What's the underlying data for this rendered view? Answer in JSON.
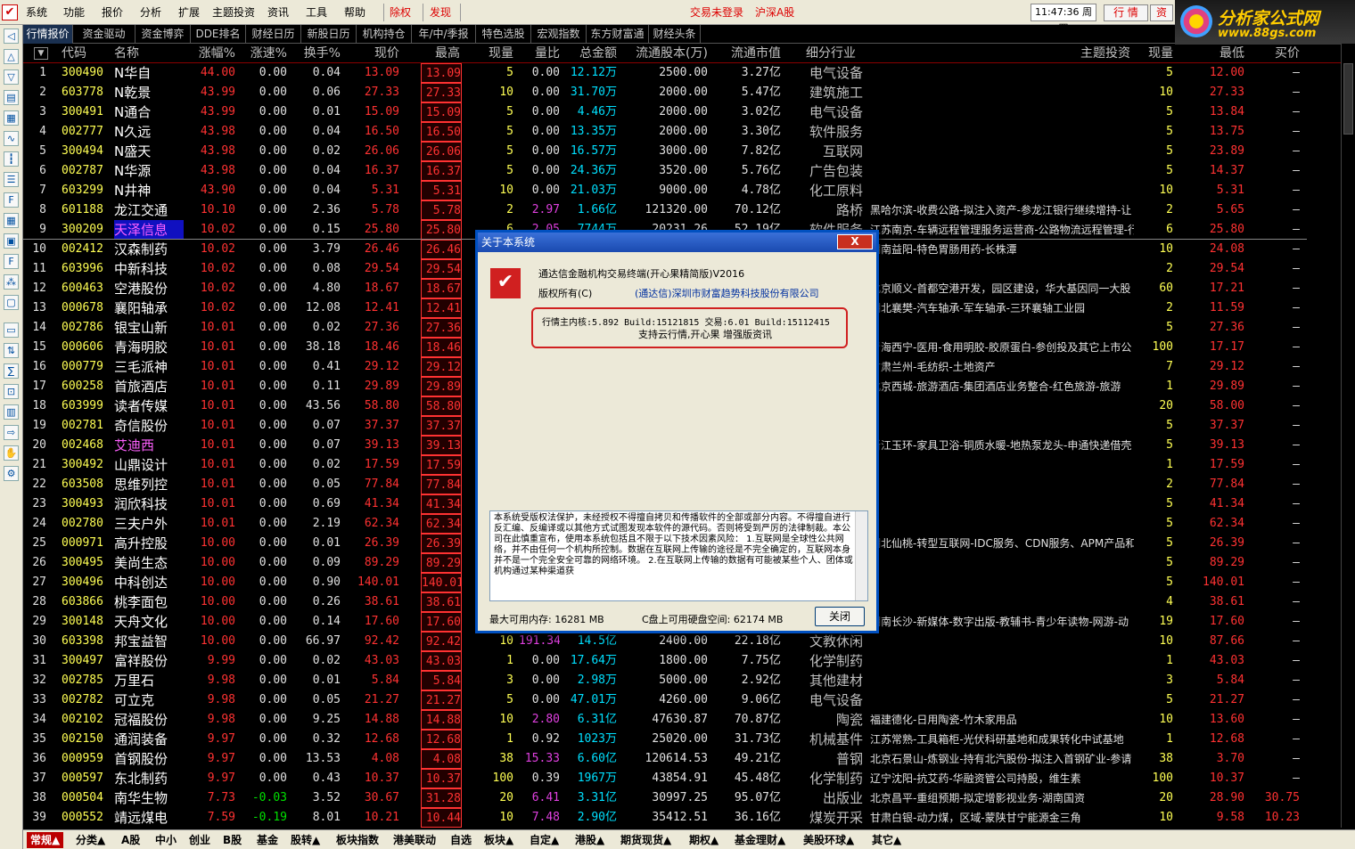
{
  "menubar": {
    "items": [
      "系统",
      "功能",
      "报价",
      "分析",
      "扩展",
      "主题投资",
      "资讯",
      "工具",
      "帮助"
    ],
    "red_items": [
      "除权",
      "发现"
    ],
    "status": "交易未登录",
    "market": "沪深A股",
    "clock": "11:47:36 周四",
    "trade_buttons": [
      "行 情",
      "资"
    ]
  },
  "brand": {
    "name": "分析家公式网",
    "url": "www.88gs.com"
  },
  "tabs": [
    "行情报价",
    "资金驱动",
    "资金博弈",
    "DDE排名",
    "财经日历",
    "新股日历",
    "机构持仓",
    "年/中/季报",
    "特色选股",
    "宏观指数",
    "东方财富通",
    "财经头条"
  ],
  "headers": [
    "代码",
    "名称",
    "涨幅%",
    "涨速%",
    "换手%",
    "现价",
    "最高",
    "现量",
    "量比",
    "总金额",
    "流通股本(万)",
    "流通市值",
    "细分行业",
    "主题投资",
    "现量",
    "最低",
    "买价"
  ],
  "rows": [
    [
      "1",
      "300490",
      "N华自",
      "44.00",
      "0.00",
      "0.04",
      "13.09",
      "13.09",
      "5",
      "0.00",
      "12.12万",
      "2500.00",
      "3.27亿",
      "电气设备",
      "",
      "5",
      "12.00",
      "—"
    ],
    [
      "2",
      "603778",
      "N乾景",
      "43.99",
      "0.00",
      "0.06",
      "27.33",
      "27.33",
      "10",
      "0.00",
      "31.70万",
      "2000.00",
      "5.47亿",
      "建筑施工",
      "",
      "10",
      "27.33",
      "—"
    ],
    [
      "3",
      "300491",
      "N通合",
      "43.99",
      "0.00",
      "0.01",
      "15.09",
      "15.09",
      "5",
      "0.00",
      "4.46万",
      "2000.00",
      "3.02亿",
      "电气设备",
      "",
      "5",
      "13.84",
      "—"
    ],
    [
      "4",
      "002777",
      "N久远",
      "43.98",
      "0.00",
      "0.04",
      "16.50",
      "16.50",
      "5",
      "0.00",
      "13.35万",
      "2000.00",
      "3.30亿",
      "软件服务",
      "",
      "5",
      "13.75",
      "—"
    ],
    [
      "5",
      "300494",
      "N盛天",
      "43.98",
      "0.00",
      "0.02",
      "26.06",
      "26.06",
      "5",
      "0.00",
      "16.57万",
      "3000.00",
      "7.82亿",
      "互联网",
      "",
      "5",
      "23.89",
      "—"
    ],
    [
      "6",
      "002787",
      "N华源",
      "43.98",
      "0.00",
      "0.04",
      "16.37",
      "16.37",
      "5",
      "0.00",
      "24.36万",
      "3520.00",
      "5.76亿",
      "广告包装",
      "",
      "5",
      "14.37",
      "—"
    ],
    [
      "7",
      "603299",
      "N井神",
      "43.90",
      "0.00",
      "0.04",
      "5.31",
      "5.31",
      "10",
      "0.00",
      "21.03万",
      "9000.00",
      "4.78亿",
      "化工原料",
      "",
      "10",
      "5.31",
      "—"
    ],
    [
      "8",
      "601188",
      "龙江交通",
      "10.10",
      "0.00",
      "2.36",
      "5.78",
      "5.78",
      "2",
      "2.97",
      "1.66亿",
      "121320.00",
      "70.12亿",
      "路桥",
      "黑哈尔滨-收费公路-拟注入资产-参龙江银行继续增持-让",
      "2",
      "5.65",
      "—"
    ],
    [
      "9",
      "300209",
      "天泽信息",
      "10.02",
      "0.00",
      "0.15",
      "25.80",
      "25.80",
      "6",
      "2.05",
      "7744万",
      "20231.26",
      "52.19亿",
      "软件服务",
      "江苏南京-车辆远程管理服务运营商-公路物流远程管理-行",
      "6",
      "25.80",
      "—"
    ],
    [
      "10",
      "002412",
      "汉森制药",
      "10.02",
      "0.00",
      "3.79",
      "26.46",
      "26.46",
      "",
      "",
      "",
      "",
      "",
      "",
      "湖南益阳-特色胃肠用药-长株潭",
      "10",
      "24.08",
      "—"
    ],
    [
      "11",
      "603996",
      "中新科技",
      "10.02",
      "0.00",
      "0.08",
      "29.54",
      "29.54",
      "",
      "",
      "",
      "",
      "",
      "",
      "",
      "2",
      "29.54",
      "—"
    ],
    [
      "12",
      "600463",
      "空港股份",
      "10.02",
      "0.00",
      "4.80",
      "18.67",
      "18.67",
      "",
      "",
      "",
      "",
      "",
      "",
      "北京顺义-首都空港开发，园区建设，华大基因同一大股",
      "60",
      "17.21",
      "—"
    ],
    [
      "13",
      "000678",
      "襄阳轴承",
      "10.02",
      "0.00",
      "12.08",
      "12.41",
      "12.41",
      "",
      "",
      "",
      "",
      "",
      "",
      "湖北襄樊-汽车轴承-军车轴承-三环襄轴工业园",
      "2",
      "11.59",
      "—"
    ],
    [
      "14",
      "002786",
      "银宝山新",
      "10.01",
      "0.00",
      "0.02",
      "27.36",
      "27.36",
      "",
      "",
      "",
      "",
      "",
      "",
      "",
      "5",
      "27.36",
      "—"
    ],
    [
      "15",
      "000606",
      "青海明胶",
      "10.01",
      "0.00",
      "38.18",
      "18.46",
      "18.46",
      "",
      "",
      "",
      "",
      "",
      "",
      "青海西宁-医用-食用明胶-胶原蛋白-参创投及其它上市公",
      "100",
      "17.17",
      "—"
    ],
    [
      "16",
      "000779",
      "三毛派神",
      "10.01",
      "0.00",
      "0.41",
      "29.12",
      "29.12",
      "",
      "",
      "",
      "",
      "",
      "",
      "甘肃兰州-毛纺织-土地资产",
      "7",
      "29.12",
      "—"
    ],
    [
      "17",
      "600258",
      "首旅酒店",
      "10.01",
      "0.00",
      "0.11",
      "29.89",
      "29.89",
      "",
      "",
      "",
      "",
      "",
      "",
      "北京西城-旅游酒店-集团酒店业务整合-红色旅游-旅游",
      "1",
      "29.89",
      "—"
    ],
    [
      "18",
      "603999",
      "读者传媒",
      "10.01",
      "0.00",
      "43.56",
      "58.80",
      "58.80",
      "",
      "",
      "",
      "",
      "",
      "",
      "",
      "20",
      "58.00",
      "—"
    ],
    [
      "19",
      "002781",
      "奇信股份",
      "10.01",
      "0.00",
      "0.07",
      "37.37",
      "37.37",
      "",
      "",
      "",
      "",
      "",
      "",
      "",
      "5",
      "37.37",
      "—"
    ],
    [
      "20",
      "002468",
      "艾迪西",
      "10.01",
      "0.00",
      "0.07",
      "39.13",
      "39.13",
      "",
      "",
      "",
      "",
      "",
      "",
      "浙江玉环-家具卫浴-铜质水暖-地热泵龙头-申通快递借壳",
      "5",
      "39.13",
      "—"
    ],
    [
      "21",
      "300492",
      "山鼎设计",
      "10.01",
      "0.00",
      "0.02",
      "17.59",
      "17.59",
      "",
      "",
      "",
      "",
      "",
      "",
      "",
      "1",
      "17.59",
      "—"
    ],
    [
      "22",
      "603508",
      "思维列控",
      "10.01",
      "0.00",
      "0.05",
      "77.84",
      "77.84",
      "",
      "",
      "",
      "",
      "",
      "",
      "",
      "2",
      "77.84",
      "—"
    ],
    [
      "23",
      "300493",
      "润欣科技",
      "10.01",
      "0.00",
      "0.69",
      "41.34",
      "41.34",
      "",
      "",
      "",
      "",
      "",
      "",
      "",
      "5",
      "41.34",
      "—"
    ],
    [
      "24",
      "002780",
      "三夫户外",
      "10.01",
      "0.00",
      "2.19",
      "62.34",
      "62.34",
      "",
      "",
      "",
      "",
      "",
      "",
      "",
      "5",
      "62.34",
      "—"
    ],
    [
      "25",
      "000971",
      "高升控股",
      "10.00",
      "0.00",
      "0.01",
      "26.39",
      "26.39",
      "",
      "",
      "",
      "",
      "",
      "",
      "湖北仙桃-转型互联网-IDC服务、CDN服务、APM产品和其",
      "5",
      "26.39",
      "—"
    ],
    [
      "26",
      "300495",
      "美尚生态",
      "10.00",
      "0.00",
      "0.09",
      "89.29",
      "89.29",
      "",
      "",
      "",
      "",
      "",
      "",
      "",
      "5",
      "89.29",
      "—"
    ],
    [
      "27",
      "300496",
      "中科创达",
      "10.00",
      "0.00",
      "0.90",
      "140.01",
      "140.01",
      "",
      "",
      "",
      "",
      "",
      "",
      "",
      "5",
      "140.01",
      "—"
    ],
    [
      "28",
      "603866",
      "桃李面包",
      "10.00",
      "0.00",
      "0.26",
      "38.61",
      "38.61",
      "",
      "",
      "",
      "",
      "",
      "",
      "",
      "4",
      "38.61",
      "—"
    ],
    [
      "29",
      "300148",
      "天舟文化",
      "10.00",
      "0.00",
      "0.14",
      "17.60",
      "17.60",
      "",
      "",
      "",
      "",
      "",
      "",
      "湖南长沙-新媒体-数字出版-教辅书-青少年读物-网游-动",
      "19",
      "17.60",
      "—"
    ],
    [
      "30",
      "603398",
      "邦宝益智",
      "10.00",
      "0.00",
      "66.97",
      "92.42",
      "92.42",
      "10",
      "191.34",
      "14.5亿",
      "2400.00",
      "22.18亿",
      "文教休闲",
      "",
      "10",
      "87.66",
      "—"
    ],
    [
      "31",
      "300497",
      "富祥股份",
      "9.99",
      "0.00",
      "0.02",
      "43.03",
      "43.03",
      "1",
      "0.00",
      "17.64万",
      "1800.00",
      "7.75亿",
      "化学制药",
      "",
      "1",
      "43.03",
      "—"
    ],
    [
      "32",
      "002785",
      "万里石",
      "9.98",
      "0.00",
      "0.01",
      "5.84",
      "5.84",
      "3",
      "0.00",
      "2.98万",
      "5000.00",
      "2.92亿",
      "其他建材",
      "",
      "3",
      "5.84",
      "—"
    ],
    [
      "33",
      "002782",
      "可立克",
      "9.98",
      "0.00",
      "0.05",
      "21.27",
      "21.27",
      "5",
      "0.00",
      "47.01万",
      "4260.00",
      "9.06亿",
      "电气设备",
      "",
      "5",
      "21.27",
      "—"
    ],
    [
      "34",
      "002102",
      "冠福股份",
      "9.98",
      "0.00",
      "9.25",
      "14.88",
      "14.88",
      "10",
      "2.80",
      "6.31亿",
      "47630.87",
      "70.87亿",
      "陶瓷",
      "福建德化-日用陶瓷-竹木家用品",
      "10",
      "13.60",
      "—"
    ],
    [
      "35",
      "002150",
      "通润装备",
      "9.97",
      "0.00",
      "0.32",
      "12.68",
      "12.68",
      "1",
      "0.92",
      "1023万",
      "25020.00",
      "31.73亿",
      "机械基件",
      "江苏常熟-工具箱柜-光伏科研基地和成果转化中试基地",
      "1",
      "12.68",
      "—"
    ],
    [
      "36",
      "000959",
      "首钢股份",
      "9.97",
      "0.00",
      "13.53",
      "4.08",
      "4.08",
      "38",
      "15.33",
      "6.60亿",
      "120614.53",
      "49.21亿",
      "普钢",
      "北京石景山-炼钢业-持有北汽股份-拟注入首钢矿业-参请",
      "38",
      "3.70",
      "—"
    ],
    [
      "37",
      "000597",
      "东北制药",
      "9.97",
      "0.00",
      "0.43",
      "10.37",
      "10.37",
      "100",
      "0.39",
      "1967万",
      "43854.91",
      "45.48亿",
      "化学制药",
      "辽宁沈阳-抗艾药-华融资管公司持股，维生素",
      "100",
      "10.37",
      "—"
    ],
    [
      "38",
      "000504",
      "南华生物",
      "7.73",
      "-0.03",
      "3.52",
      "30.67",
      "31.28",
      "20",
      "6.41",
      "3.31亿",
      "30997.25",
      "95.07亿",
      "出版业",
      "北京昌平-重组预期-拟定增影视业务-湖南国资",
      "20",
      "28.90",
      "30.75"
    ],
    [
      "39",
      "000552",
      "靖远煤电",
      "7.59",
      "-0.19",
      "8.01",
      "10.21",
      "10.44",
      "10",
      "7.48",
      "2.90亿",
      "35412.51",
      "36.16亿",
      "煤炭开采",
      "甘肃白银-动力煤，区域-蒙陕甘宁能源金三角",
      "10",
      "9.58",
      "10.23"
    ]
  ],
  "bottom_tabs": [
    "常规▲",
    "分类▲",
    "A股",
    "中小",
    "创业",
    "B股",
    "基金",
    "股转▲",
    "板块指数",
    "港美联动",
    "自选",
    "板块▲",
    "自定▲",
    "港股▲",
    "期货现货▲",
    "期权▲",
    "基金理财▲",
    "美股环球▲",
    "其它▲"
  ],
  "dialog": {
    "title": "关于本系统",
    "close": "X",
    "product": "通达信金融机构交易终端(开心果精简版)V2016",
    "copyright_label": "版权所有(C)",
    "company": "(通达信)深圳市财富趋势科技股份有限公司",
    "version_line": "行情主内核:5.892 Build:15121815 交易:6.01 Build:15112415",
    "support_line": "支持云行情,开心果 增强版资讯",
    "license_text": "本系统受版权法保护，未经授权不得擅自拷贝和传播软件的全部或部分内容。不得擅自进行反汇编、反编译或以其他方式试图发现本软件的源代码。否则将受到严厉的法律制裁。本公司在此慎重宣布，使用本系统包括且不限于以下技术因素风险： 1.互联网是全球性公共网络，并不由任何一个机构所控制。数据在互联网上传输的途径是不完全确定的，互联网本身并不是一个完全安全可靠的网络环境。 2.在互联网上传输的数据有可能被某些个人、团体或机构通过某种渠道获",
    "mem": "最大可用内存:  16281 MB",
    "disk": "C盘上可用硬盘空间:  62174 MB",
    "ok": "关闭"
  }
}
